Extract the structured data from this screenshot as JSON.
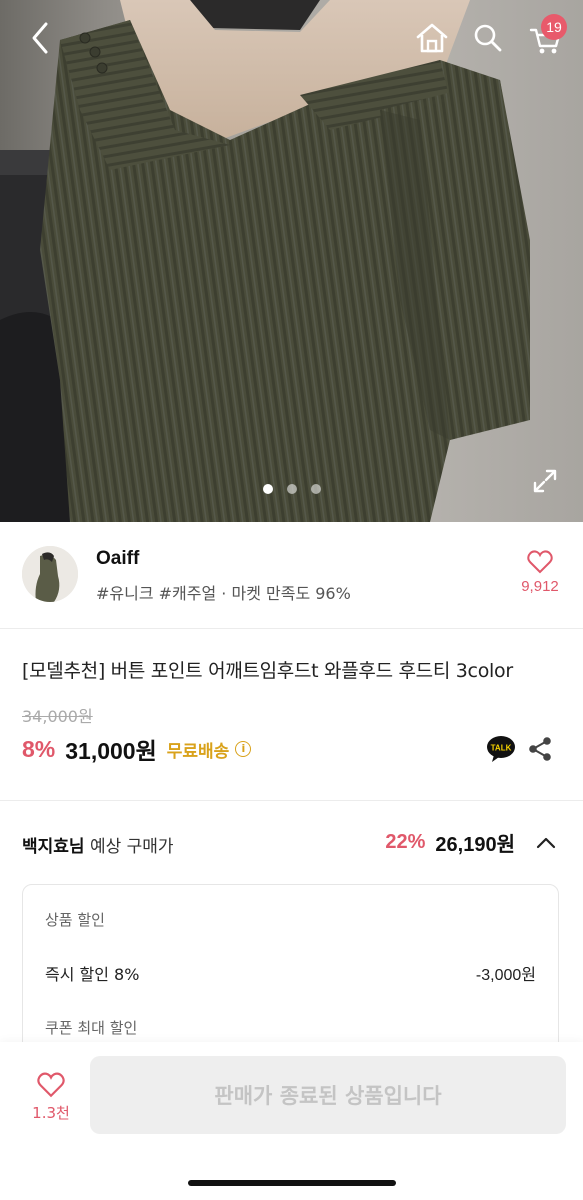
{
  "header": {
    "cart_badge": "19",
    "icons": [
      "back-icon",
      "home-icon",
      "search-icon",
      "cart-icon",
      "expand-icon"
    ],
    "image_pager": {
      "count": 3,
      "active": 1
    }
  },
  "shop": {
    "name": "Oaiff",
    "tags": "#유니크 #캐주얼 · 마켓 만족도 96%",
    "like_count": "9,912"
  },
  "product": {
    "title": "[모델추천] 버튼 포인트 어깨트임후드t 와플후드 후드티 3color",
    "original_price": "34,000원",
    "discount": "8%",
    "price": "31,000원",
    "free_shipping": "무료배송",
    "info_icon": "i",
    "talk_label": "TALK"
  },
  "expected": {
    "user": "백지효님",
    "label": "예상 구매가",
    "discount": "22%",
    "price": "26,190원"
  },
  "discount_detail": {
    "section_title": "상품 할인",
    "rows": [
      {
        "label": "즉시 할인 8%",
        "value": "-3,000원"
      }
    ],
    "coupon_title": "쿠폰 최대 할인"
  },
  "bottom": {
    "wish_count": "1.3천",
    "sold_out_label": "판매가 종료된 상품입니다"
  },
  "colors": {
    "accent_pink": "#e0586a",
    "free_ship_gold": "#d9a21b",
    "badge": "#e85a6b"
  }
}
